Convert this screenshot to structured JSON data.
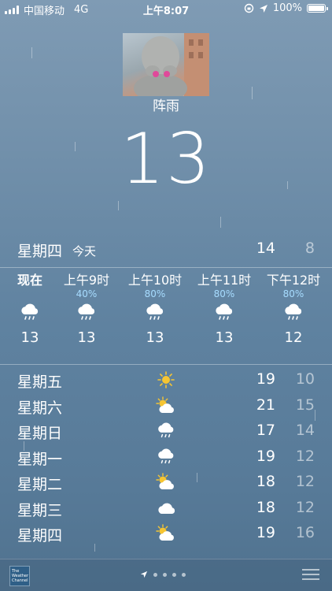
{
  "status_bar": {
    "carrier": "中国移动",
    "network": "4G",
    "time": "上午8:07",
    "battery": "100%"
  },
  "current": {
    "condition": "阵雨",
    "temperature": "13"
  },
  "today": {
    "day": "星期四",
    "tag": "今天",
    "high": "14",
    "low": "8"
  },
  "hourly": [
    {
      "label": "现在",
      "pop": "",
      "icon": "rain-cloud-icon",
      "temp": "13"
    },
    {
      "label": "上午9时",
      "pop": "40%",
      "icon": "rain-cloud-icon",
      "temp": "13"
    },
    {
      "label": "上午10时",
      "pop": "80%",
      "icon": "rain-cloud-icon",
      "temp": "13"
    },
    {
      "label": "上午11时",
      "pop": "80%",
      "icon": "rain-cloud-icon",
      "temp": "13"
    },
    {
      "label": "下午12时",
      "pop": "80%",
      "icon": "rain-cloud-icon",
      "temp": "12"
    }
  ],
  "daily": [
    {
      "day": "星期五",
      "icon": "sun-icon",
      "high": "19",
      "low": "10"
    },
    {
      "day": "星期六",
      "icon": "partly-cloudy-icon",
      "high": "21",
      "low": "15"
    },
    {
      "day": "星期日",
      "icon": "rain-cloud-icon",
      "high": "17",
      "low": "14"
    },
    {
      "day": "星期一",
      "icon": "rain-cloud-icon",
      "high": "19",
      "low": "12"
    },
    {
      "day": "星期二",
      "icon": "partly-cloudy-icon",
      "high": "18",
      "low": "12"
    },
    {
      "day": "星期三",
      "icon": "cloud-icon",
      "high": "18",
      "low": "12"
    },
    {
      "day": "星期四",
      "icon": "partly-cloudy-icon",
      "high": "19",
      "low": "16"
    }
  ],
  "bottom_bar": {
    "logo_text": "The Weather Channel"
  },
  "colors": {
    "precip_text": "#a7dcff",
    "sun": "#f6c532"
  }
}
